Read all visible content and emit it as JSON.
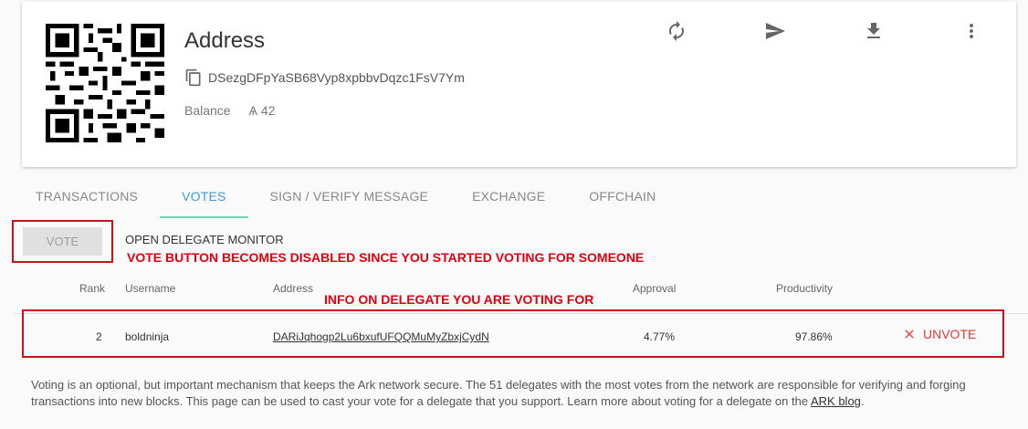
{
  "wallet": {
    "title": "Address",
    "address": "DSezgDFpYaSB68Vyp8xpbbvDqzc1FsV7Ym",
    "balance_label": "Balance",
    "balance_value": "Ѧ 42"
  },
  "toolbar": {
    "refresh_icon": "refresh-icon",
    "send_icon": "send-icon",
    "download_icon": "download-icon",
    "menu_icon": "more-vert-icon"
  },
  "tabs": [
    {
      "label": "TRANSACTIONS",
      "active": false
    },
    {
      "label": "VOTES",
      "active": true
    },
    {
      "label": "SIGN / VERIFY MESSAGE",
      "active": false
    },
    {
      "label": "EXCHANGE",
      "active": false
    },
    {
      "label": "OFFCHAIN",
      "active": false
    }
  ],
  "votes": {
    "vote_button": "VOTE",
    "monitor_link": "OPEN DELEGATE MONITOR",
    "annotation_vote": "VOTE BUTTON BECOMES DISABLED SINCE YOU STARTED VOTING FOR SOMEONE",
    "annotation_info": "INFO ON DELEGATE YOU ARE VOTING FOR",
    "columns": {
      "rank": "Rank",
      "username": "Username",
      "address": "Address",
      "approval": "Approval",
      "productivity": "Productivity"
    },
    "row": {
      "rank": "2",
      "username": "boldninja",
      "address": "DARiJqhogp2Lu6bxufUFQQMuMyZbxjCydN",
      "approval": "4.77%",
      "productivity": "97.86%",
      "unvote_label": "UNVOTE"
    }
  },
  "info": {
    "text": "Voting is an optional, but important mechanism that keeps the Ark network secure. The 51 delegates with the most votes from the network are responsible for verifying and forging transactions into new blocks. This page can be used to cast your vote for a delegate that you support. Learn more about voting for a delegate on the ",
    "link": "ARK blog",
    "end": "."
  },
  "colors": {
    "accent": "#3b9bd6",
    "tab_underline": "#6fd0b8",
    "annotation": "#e00010",
    "unvote": "#e53935"
  }
}
